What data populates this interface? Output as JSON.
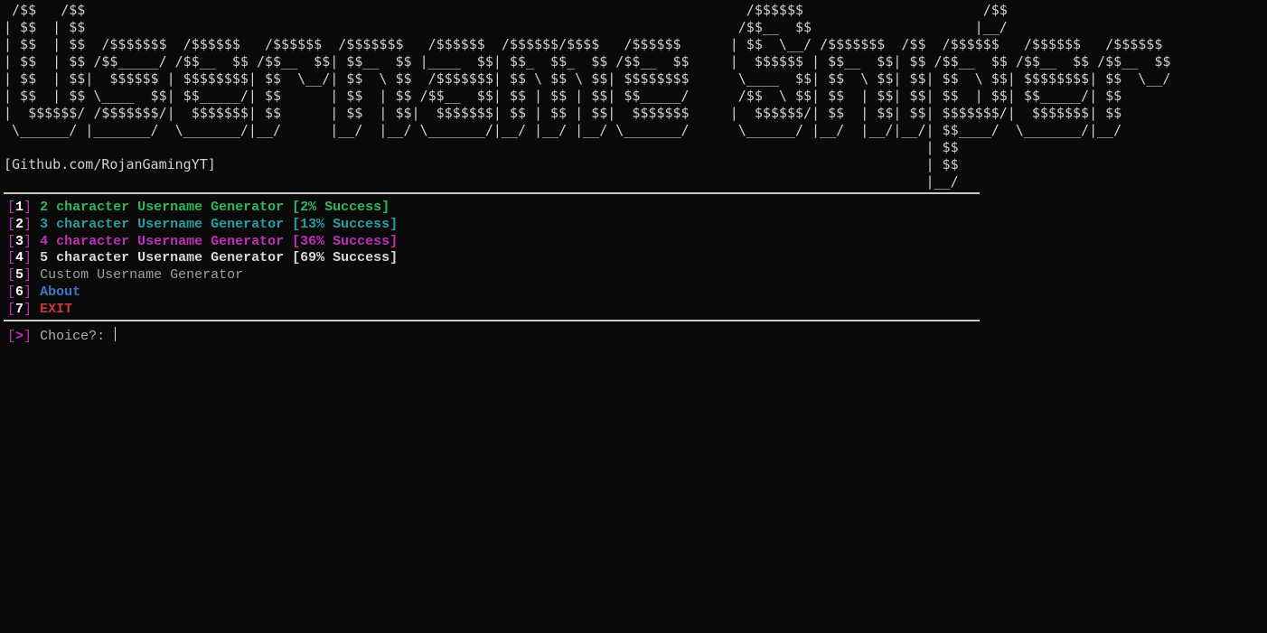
{
  "ascii_art": " /$$   /$$                                                                                 /$$$$$$                      /$$\n| $$  | $$                                                                                /$$__  $$                    |__/\n| $$  | $$  /$$$$$$$  /$$$$$$   /$$$$$$  /$$$$$$$   /$$$$$$  /$$$$$$/$$$$   /$$$$$$      | $$  \\__/ /$$$$$$$  /$$  /$$$$$$   /$$$$$$   /$$$$$$\n| $$  | $$ /$$_____/ /$$__  $$ /$$__  $$| $$__  $$ |____  $$| $$_  $$_  $$ /$$__  $$     |  $$$$$$ | $$__  $$| $$ /$$__  $$ /$$__  $$ /$$__  $$\n| $$  | $$|  $$$$$$ | $$$$$$$$| $$  \\__/| $$  \\ $$  /$$$$$$$| $$ \\ $$ \\ $$| $$$$$$$$      \\____  $$| $$  \\ $$| $$| $$  \\ $$| $$$$$$$$| $$  \\__/\n| $$  | $$ \\____  $$| $$_____/| $$      | $$  | $$ /$$__  $$| $$ | $$ | $$| $$_____/      /$$  \\ $$| $$  | $$| $$| $$  | $$| $$_____/| $$\n|  $$$$$$/ /$$$$$$$/|  $$$$$$$| $$      | $$  | $$|  $$$$$$$| $$ | $$ | $$|  $$$$$$$     |  $$$$$$/| $$  | $$| $$| $$$$$$$/|  $$$$$$$| $$\n \\______/ |_______/  \\_______/|__/      |__/  |__/ \\_______/|__/ |__/ |__/ \\_______/      \\______/ |__/  |__/|__/| $$____/  \\_______/|__/\n                                                                                                                 | $$\n[Github.com/RojanGamingYT]                                                                                       | $$\n                                                                                                                 |__/",
  "menu": [
    {
      "num": "1",
      "label": "2 character Username Generator [2% Success]",
      "class": "green"
    },
    {
      "num": "2",
      "label": "3 character Username Generator [13% Success]",
      "class": "cyan"
    },
    {
      "num": "3",
      "label": "4 character Username Generator [36% Success]",
      "class": "magenta"
    },
    {
      "num": "4",
      "label": "5 character Username Generator [69% Success]",
      "class": "white"
    },
    {
      "num": "5",
      "label": "Custom Username Generator",
      "class": "gray"
    },
    {
      "num": "6",
      "label": "About",
      "class": "blue"
    },
    {
      "num": "7",
      "label": "EXIT",
      "class": "red"
    }
  ],
  "prompt": {
    "symbol": ">",
    "label": "Choice?:"
  }
}
